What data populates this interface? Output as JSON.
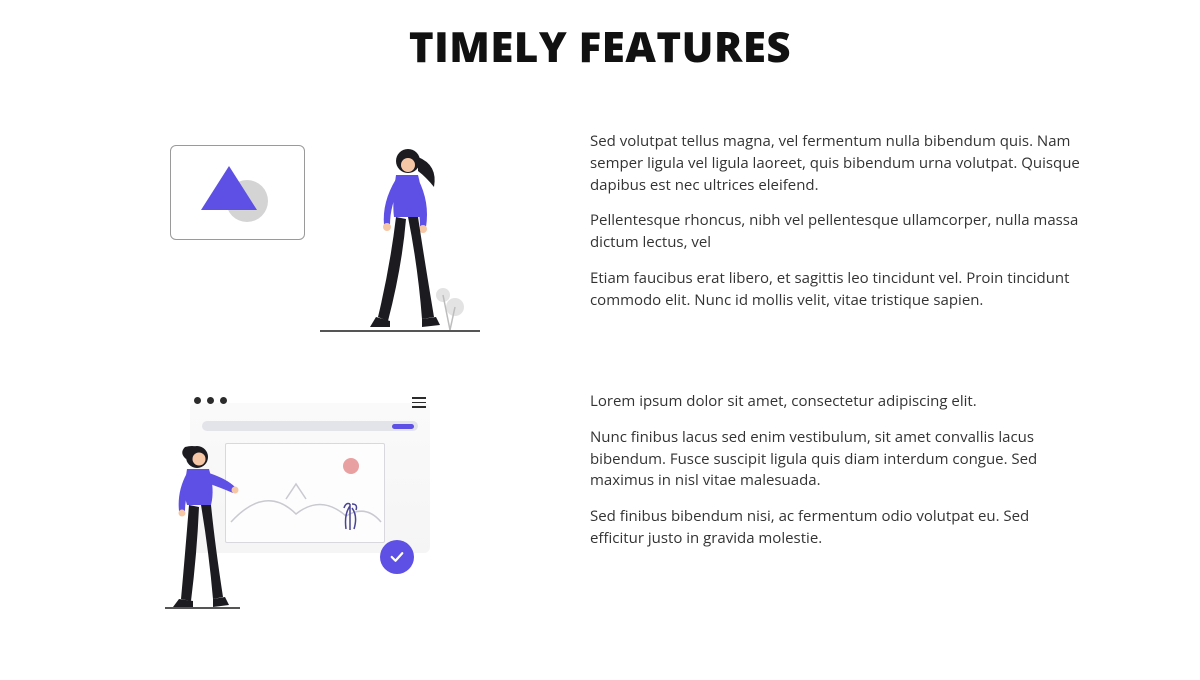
{
  "title": "TIMELY FEATURES",
  "features": [
    {
      "paragraphs": [
        "Sed volutpat tellus magna, vel fermentum nulla bibendum quis. Nam semper ligula vel ligula laoreet, quis bibendum urna volutpat. Quisque dapibus est nec ultrices eleifend.",
        "Pellentesque rhoncus, nibh vel pellentesque ullamcorper, nulla massa dictum lectus, vel",
        "Etiam faucibus erat libero, et sagittis leo tincidunt vel. Proin tincidunt commodo elit. Nunc id mollis velit, vitae tristique sapien."
      ]
    },
    {
      "paragraphs": [
        "Lorem ipsum dolor sit amet, consectetur adipiscing elit.",
        "Nunc finibus lacus sed enim vestibulum, sit amet convallis lacus bibendum. Fusce suscipit ligula quis diam interdum congue. Sed maximus in nisl vitae malesuada.",
        "Sed finibus bibendum nisi, ac fermentum odio volutpat eu. Sed efficitur justo in gravida molestie."
      ],
      "highlighted_index": 2
    }
  ],
  "colors": {
    "accent": "#5e50e4",
    "highlight_bg": "#e6e6e6"
  }
}
